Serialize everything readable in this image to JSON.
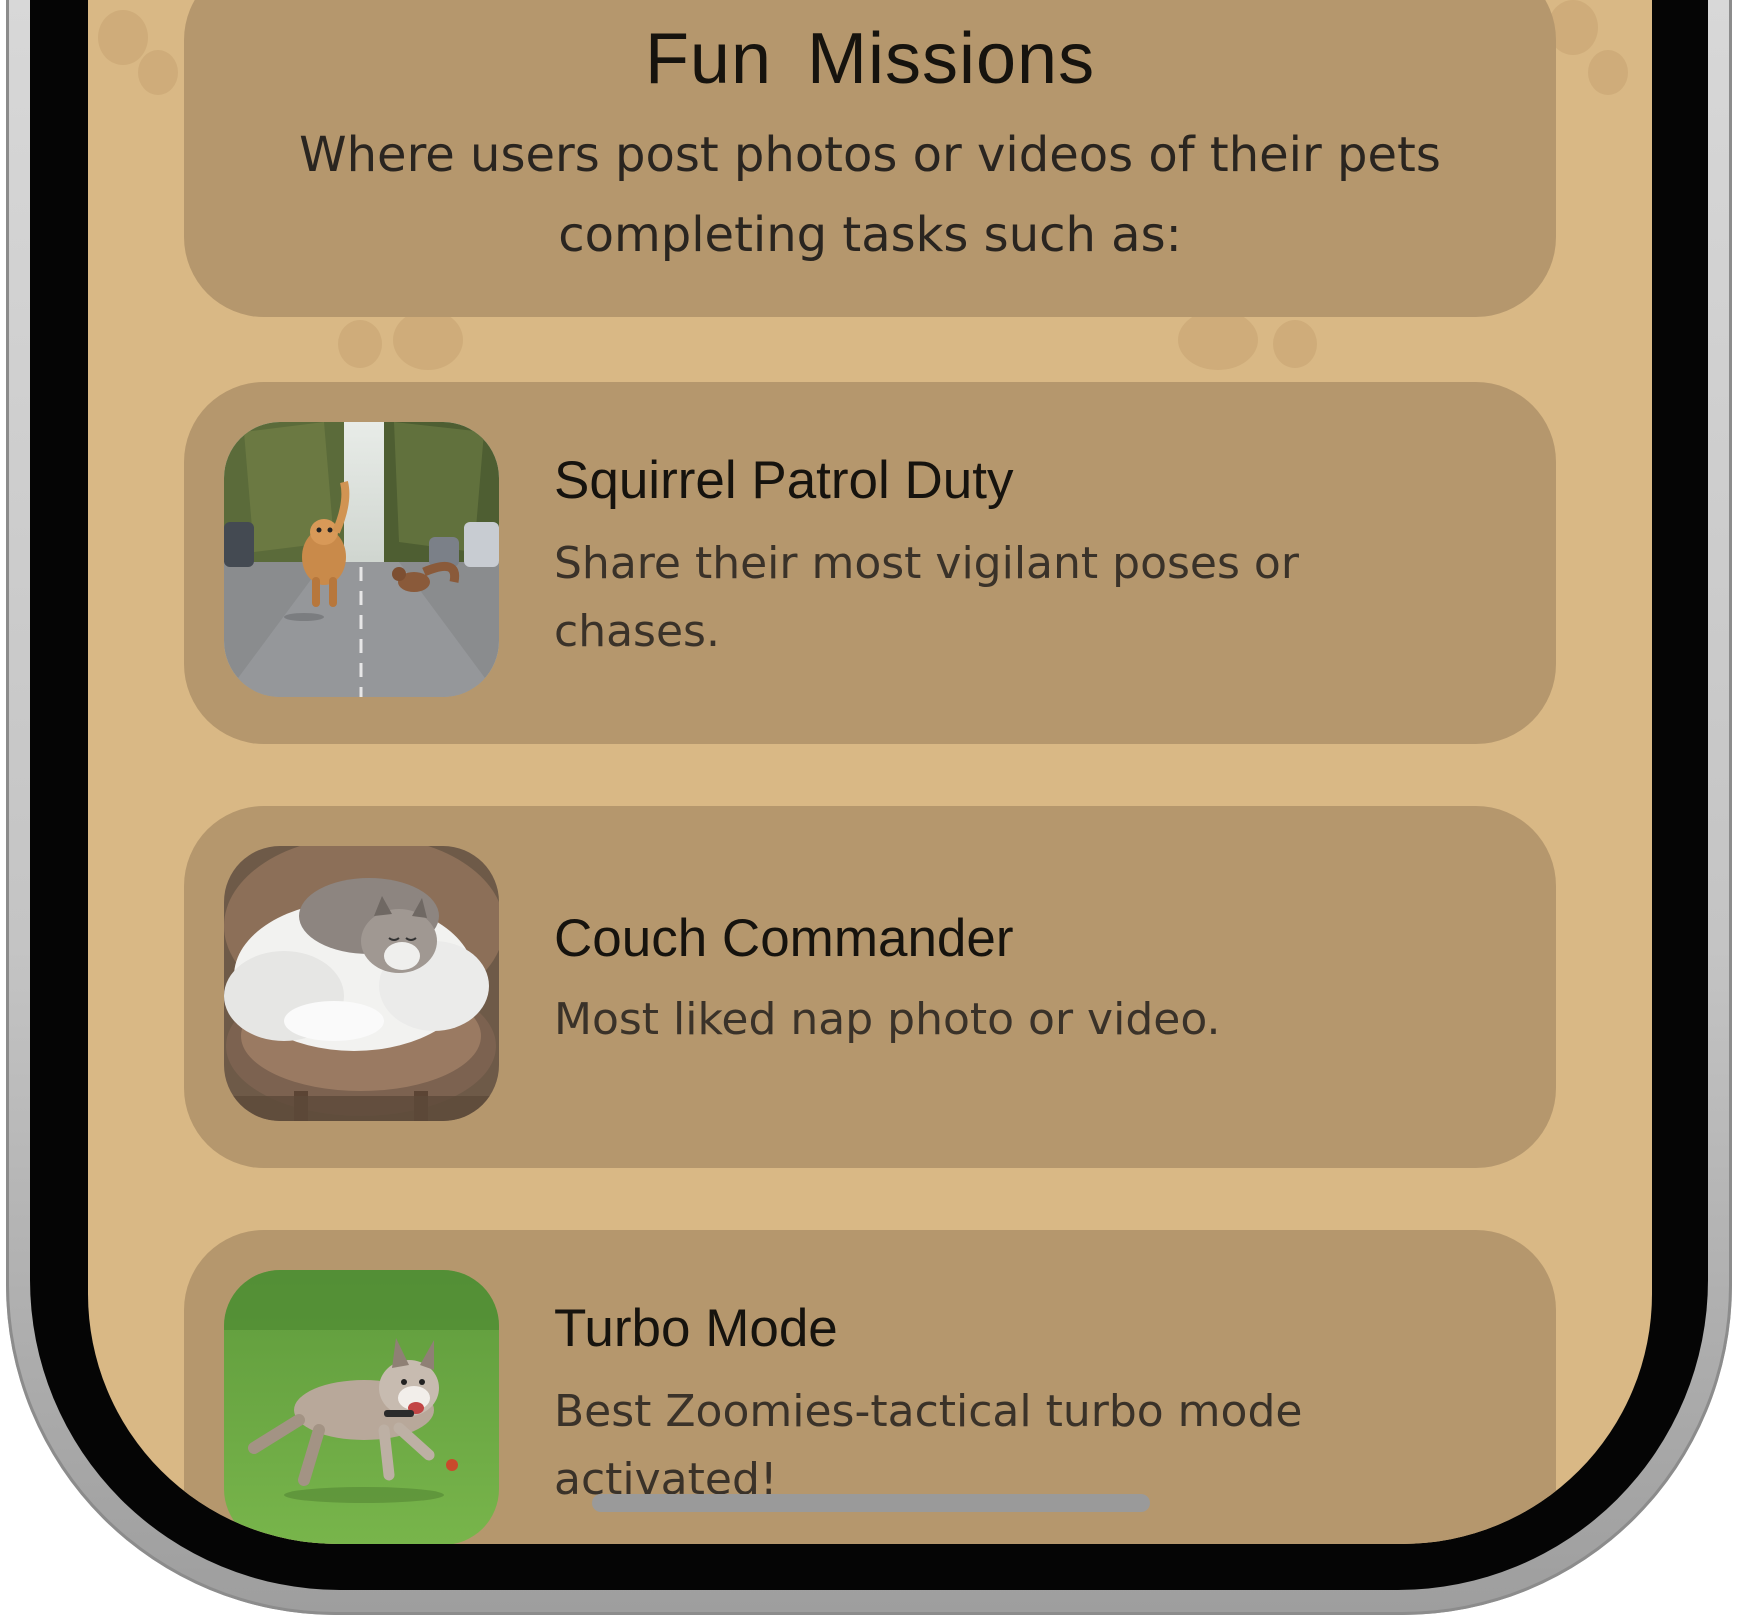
{
  "header": {
    "title": "Fun  Missions",
    "subtitle": "Where users post photos or videos of their pets completing tasks such as:"
  },
  "missions": [
    {
      "title": "Squirrel Patrol Duty",
      "description": "Share their most vigilant poses or chases.",
      "image": "dog-chasing-squirrel-photo"
    },
    {
      "title": "Couch Commander",
      "description": "Most liked nap photo or video.",
      "image": "cat-napping-in-bed-photo"
    },
    {
      "title": "Turbo Mode",
      "description": "Best Zoomies-tactical turbo mode activated!",
      "image": "french-bulldog-running-photo"
    }
  ],
  "colors": {
    "background": "#d9b885",
    "card": "#b5976d",
    "title_text": "#16130e",
    "body_text": "#3a3229",
    "frame_bezel": "#050505",
    "home_indicator": "#9a9a9a"
  }
}
